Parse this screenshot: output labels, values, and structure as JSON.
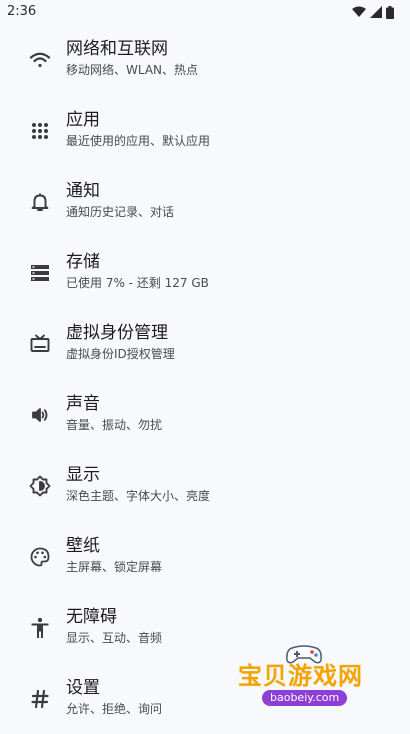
{
  "status_bar": {
    "time": "2:36",
    "icons": [
      "wifi-icon",
      "signal-icon",
      "battery-icon"
    ]
  },
  "settings": {
    "items": [
      {
        "icon": "wifi-icon",
        "title": "网络和互联网",
        "subtitle": "移动网络、WLAN、热点"
      },
      {
        "icon": "apps-grid-icon",
        "title": "应用",
        "subtitle": "最近使用的应用、默认应用"
      },
      {
        "icon": "bell-icon",
        "title": "通知",
        "subtitle": "通知历史记录、对话"
      },
      {
        "icon": "storage-icon",
        "title": "存储",
        "subtitle": "已使用 7% - 还剩 127 GB"
      },
      {
        "icon": "tv-icon",
        "title": "虚拟身份管理",
        "subtitle": "虚拟身份ID授权管理"
      },
      {
        "icon": "volume-icon",
        "title": "声音",
        "subtitle": "音量、振动、勿扰"
      },
      {
        "icon": "brightness-icon",
        "title": "显示",
        "subtitle": "深色主题、字体大小、亮度"
      },
      {
        "icon": "palette-icon",
        "title": "壁纸",
        "subtitle": "主屏幕、锁定屏幕"
      },
      {
        "icon": "accessibility-icon",
        "title": "无障碍",
        "subtitle": "显示、互动、音频"
      },
      {
        "icon": "hash-icon",
        "title": "设置",
        "subtitle": "允许、拒绝、询问"
      }
    ]
  },
  "watermark": {
    "text": "宝贝游戏网",
    "url": "baobeiy.com"
  },
  "colors": {
    "background": "#f7f9fc",
    "icon": "#3c3c40",
    "watermark_orange": "#f5a300",
    "watermark_purple": "#8e3fd6"
  }
}
